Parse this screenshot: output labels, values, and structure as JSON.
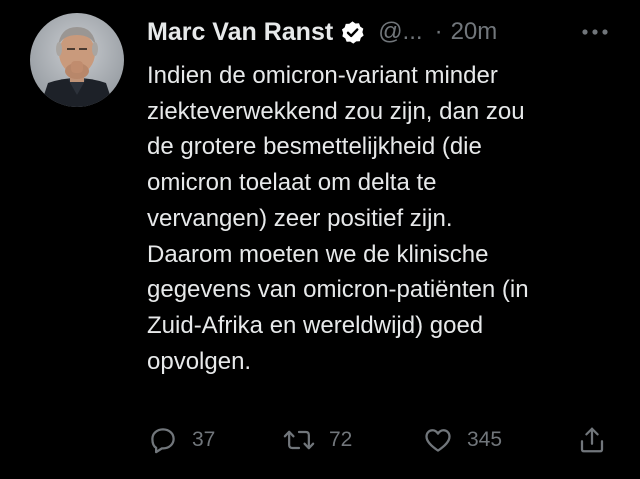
{
  "author": {
    "name": "Marc Van Ranst",
    "handle": "@...",
    "separator": "·",
    "time": "20m",
    "verified": true
  },
  "tweet": {
    "lines": [
      "Indien de omicron-variant minder",
      "ziekteverwekkend zou zijn, dan zou",
      "de grotere besmettelijkheid (die",
      "omicron toelaat om delta te",
      "vervangen) zeer positief zijn.",
      "Daarom moeten we de klinische",
      "gegevens van omicron-patiënten (in",
      "Zuid-Afrika en wereldwijd) goed",
      "opvolgen."
    ]
  },
  "actions": {
    "reply_count": "37",
    "retweet_count": "72",
    "like_count": "345"
  },
  "icons": {
    "more": "more-options-icon",
    "reply": "reply-icon",
    "retweet": "retweet-icon",
    "like": "heart-icon",
    "share": "share-icon",
    "verified": "verified-badge-icon"
  },
  "colors": {
    "background": "#000000",
    "text_primary": "#e7e9ea",
    "text_secondary": "#71767b",
    "verified_badge": "#ffffff"
  }
}
